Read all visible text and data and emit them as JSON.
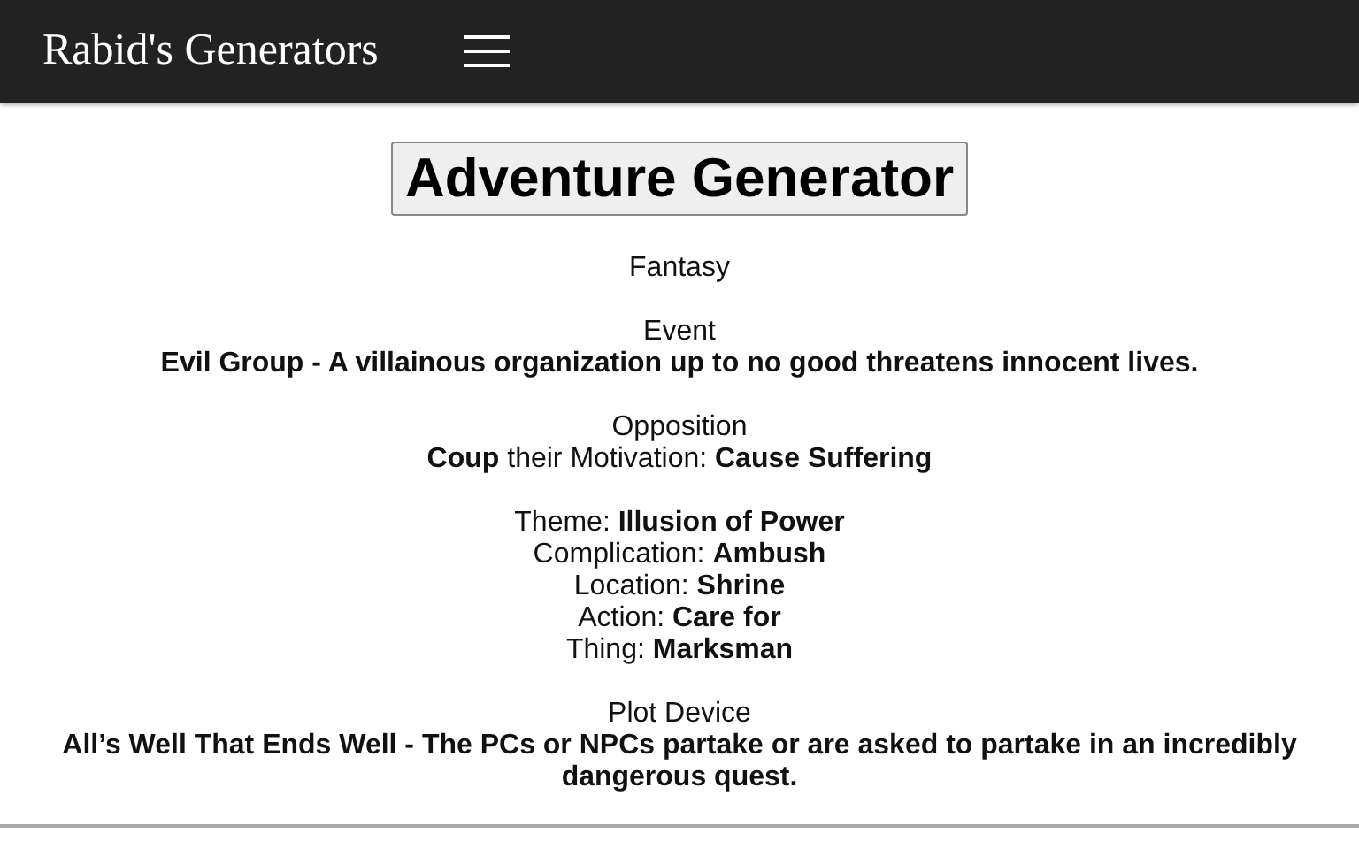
{
  "navbar": {
    "brand": "Rabid's Generators"
  },
  "generate_button": "Adventure Generator",
  "genre": "Fantasy",
  "sections": [
    {
      "kind": "described",
      "heading": "Event",
      "text": "Evil Group - A villainous organization up to no good threatens innocent lives."
    },
    {
      "kind": "mixed",
      "heading": "Opposition",
      "text": "**Coup** their Motivation: **Cause Suffering**"
    },
    {
      "kind": "fields",
      "fields": [
        {
          "label": "Theme:",
          "value": "Illusion of Power"
        },
        {
          "label": "Complication:",
          "value": "Ambush"
        },
        {
          "label": "Location:",
          "value": "Shrine"
        },
        {
          "label": "Action:",
          "value": "Care for"
        },
        {
          "label": "Thing:",
          "value": "Marksman"
        }
      ]
    },
    {
      "kind": "described",
      "heading": "Plot Device",
      "text": "All’s Well That Ends Well - The PCs or NPCs partake or are asked to partake in an incredibly dangerous quest."
    }
  ]
}
